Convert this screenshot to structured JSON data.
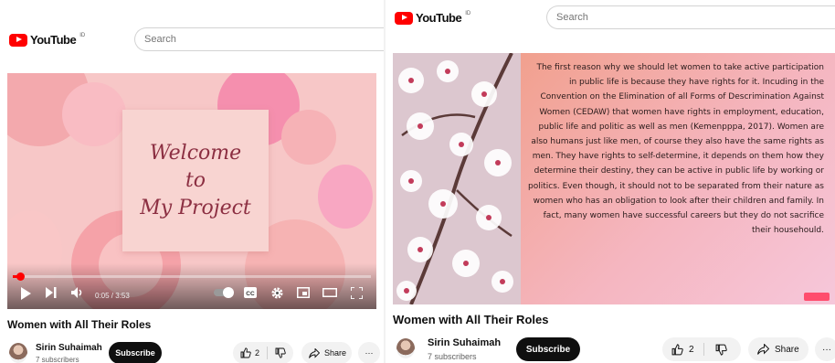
{
  "app": "YouTube",
  "logo": {
    "text": "YouTube",
    "region": "ID"
  },
  "search": {
    "placeholder": "Search"
  },
  "left_player": {
    "welcome_lines": [
      "Welcome",
      "to",
      "My Project"
    ],
    "time": "0:05 / 3:53",
    "progress": 0.021,
    "icons": [
      "play-icon",
      "next-icon",
      "volume-icon",
      "autoplay-toggle",
      "subtitles-icon",
      "settings-icon",
      "miniplayer-icon",
      "theater-icon",
      "fullscreen-icon"
    ]
  },
  "right_player": {
    "essay": "The first reason why we should let women to take active participation in public life is because they have rights for it. Incuding in the Convention on the Elimination of all Forms of Descrimination Against Women (CEDAW) that women have rights in employment, education, public life and politic as well as men (Kemenpppa, 2017). Women are also humans just like men, of course they also have the same rights as men. They have rights to self-determine, it depends on them how they determine their destiny, they can be active in public life by working or politics. Even though, it should not to be separated from their nature as women who has an obligation to look after their children and family. In fact, many women have successful careers but they do not sacrifice their househould."
  },
  "video": {
    "title": "Women with All Their Roles"
  },
  "channel": {
    "name": "Sirin Suhaimah",
    "subscribers": "7 subscribers"
  },
  "actions": {
    "subscribe": "Subscribe",
    "likes": "2",
    "share": "Share",
    "more": "···"
  },
  "colors": {
    "brand": "#ff0000",
    "subscribe_bg": "#0f0f0f",
    "pill_bg": "#f2f2f2"
  }
}
